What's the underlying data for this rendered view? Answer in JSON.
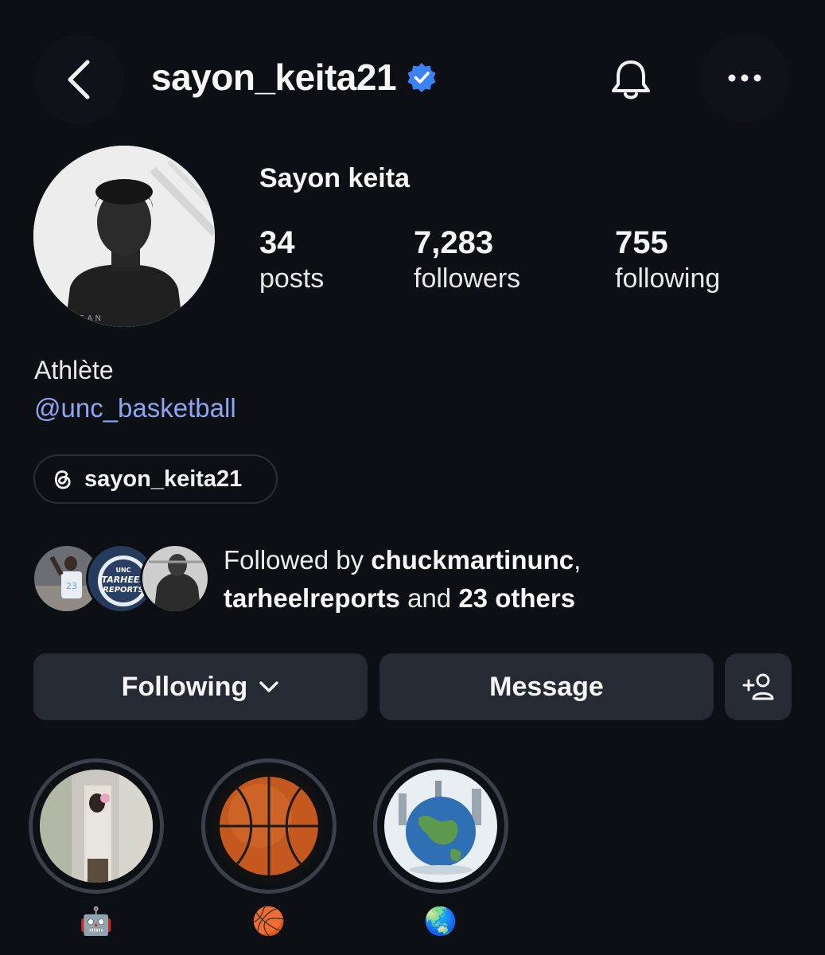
{
  "header": {
    "username": "sayon_keita21",
    "verified": true,
    "icons": [
      "back-arrow-icon",
      "verified-badge-icon",
      "bell-icon",
      "more-options-icon"
    ]
  },
  "profile": {
    "display_name": "Sayon keita",
    "avatar_letters": "S A N",
    "stats": {
      "posts": {
        "value": "34",
        "label": "posts"
      },
      "followers": {
        "value": "7,283",
        "label": "followers"
      },
      "following": {
        "value": "755",
        "label": "following"
      }
    },
    "bio": {
      "category": "Athlète",
      "link": "@unc_basketball"
    },
    "threads": {
      "label": "sayon_keita21",
      "icon": "threads-icon"
    }
  },
  "followed_by": {
    "prefix": "Followed by ",
    "user1": "chuckmartinunc",
    "comma": ",",
    "user2": "tarheelreports",
    "conjunction": " and ",
    "others": "23 others",
    "badge_text": [
      "UNC",
      "TARHEEL",
      "REPORTS"
    ],
    "jersey_number": "23"
  },
  "actions": {
    "following_label": "Following",
    "message_label": "Message",
    "add_icon": "add-person-icon"
  },
  "highlights": [
    {
      "label": "🤖"
    },
    {
      "label": "🏀"
    },
    {
      "label": "🌏"
    }
  ],
  "colors": {
    "background": "#0c0f14",
    "button": "#262a33",
    "link": "#8ea6f2",
    "verified": "#3b82f6"
  }
}
